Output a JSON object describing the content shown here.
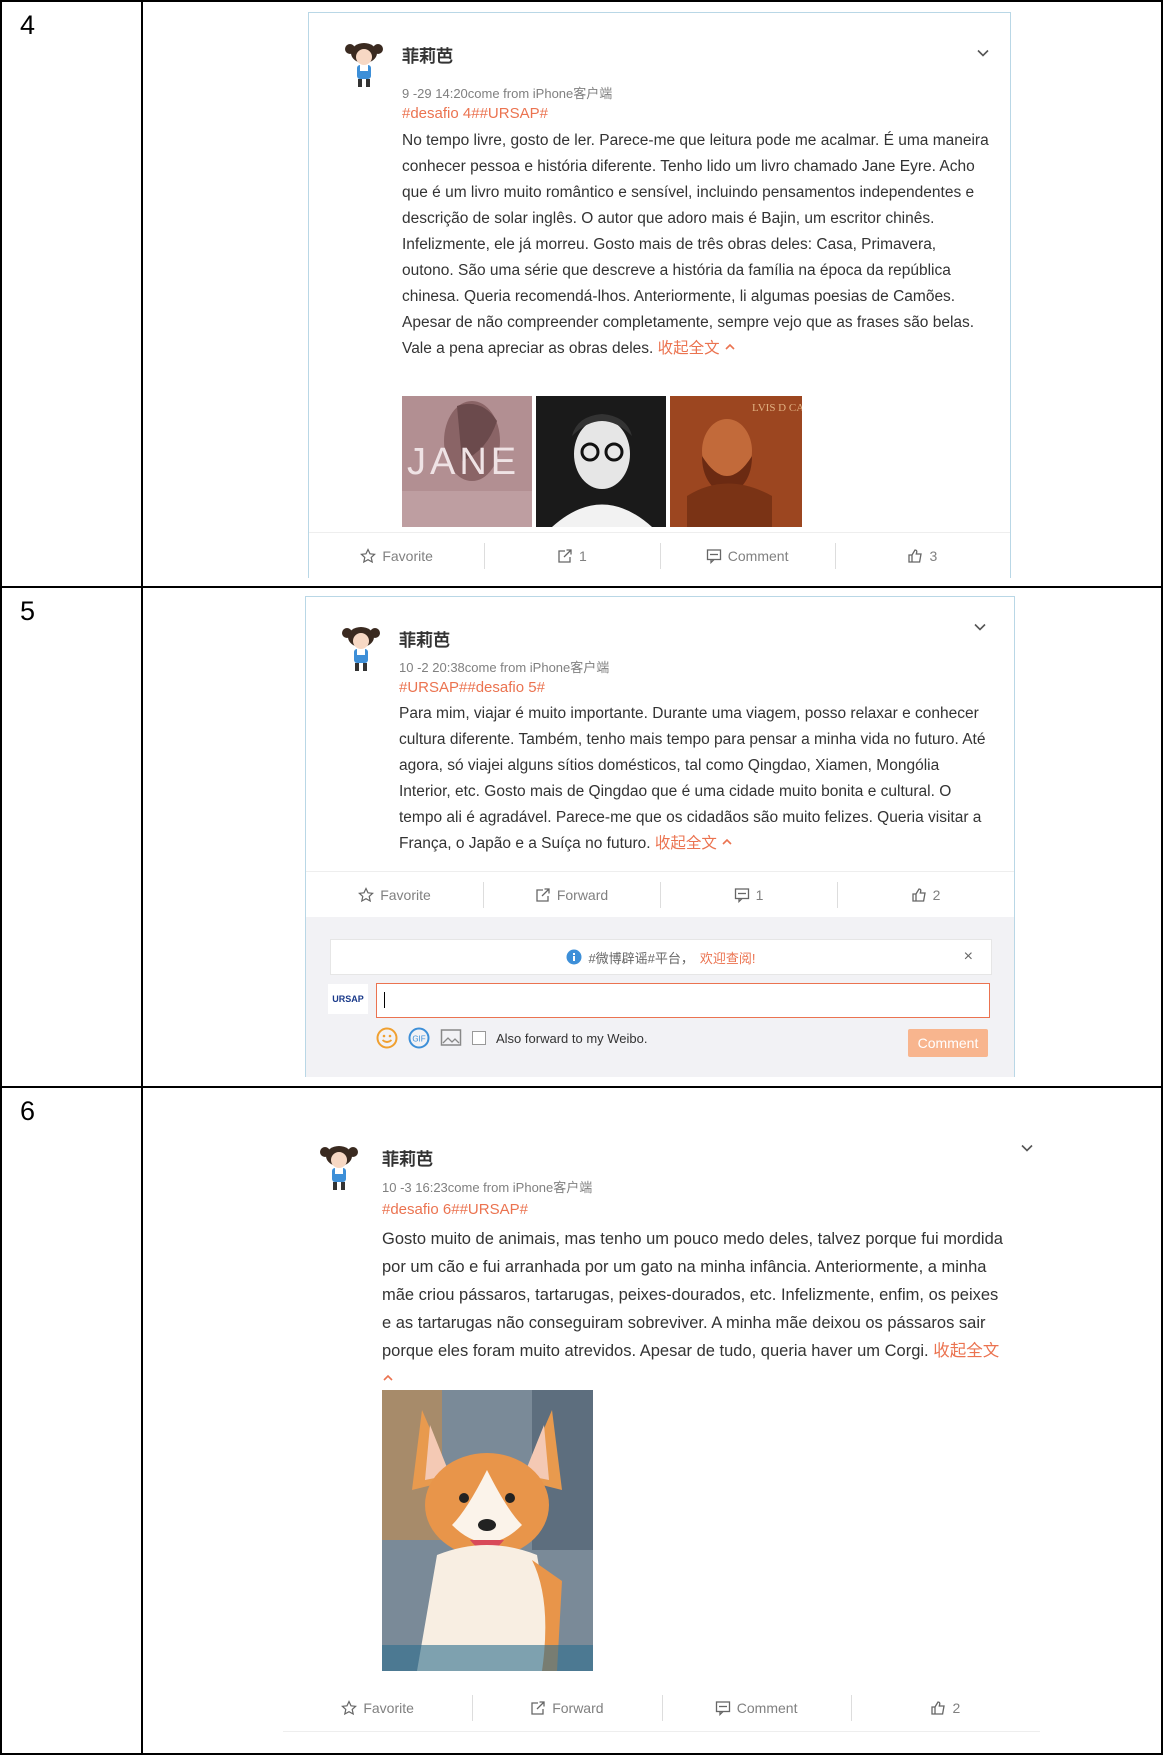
{
  "rows": [
    {
      "num": "4",
      "user": "菲莉芭",
      "meta": "9 -29 14:20come from iPhone客户端",
      "tags": "#desafio 4##URSAP#",
      "text": "No tempo livre, gosto de ler. Parece-me que leitura pode me acalmar. É uma maneira conhecer pessoa e história diferente. Tenho lido um livro chamado Jane Eyre. Acho que é um livro muito romântico e sensível, incluindo pensamentos independentes e descrição de solar inglês. O autor que adoro mais é Bajin, um escritor chinês. Infelizmente, ele já morreu. Gosto mais de três obras deles: Casa, Primavera, outono. São uma série que descreve a história da família na época da república chinesa. Queria recomendá-lhos. Anteriormente, li algumas poesias de Camões. Apesar de não compreender completamente, sempre vejo que as frases são belas. Vale a pena apreciar as obras deles.",
      "collapse": "收起全文",
      "image_texts": {
        "book_title": "JANE EYRE",
        "painting": "LVIS D CAMO"
      },
      "actions": {
        "favorite": "Favorite",
        "forward": "1",
        "comment": "Comment",
        "like": "3"
      }
    },
    {
      "num": "5",
      "user": "菲莉芭",
      "meta": "10 -2 20:38come from iPhone客户端",
      "tags": "#URSAP##desafio 5#",
      "text": "Para mim, viajar é muito importante. Durante uma viagem, posso relaxar e conhecer cultura diferente. Também, tenho mais tempo para pensar a minha vida no futuro. Até agora, só viajei alguns sítios domésticos, tal como Qingdao, Xiamen, Mongólia Interior, etc. Gosto mais de Qingdao que é uma cidade muito bonita e cultural. O tempo ali é agradável. Parece-me que os cidadãos são muito felizes. Queria visitar a França, o Japão e a Suíça no futuro.",
      "collapse": "收起全文",
      "actions": {
        "favorite": "Favorite",
        "forward": "Forward",
        "comment": "1",
        "like": "2"
      },
      "comment_panel": {
        "notice": "#微博辟谣#平台，",
        "notice_link": "欢迎查阅!",
        "close": "×",
        "logo": "URSAP",
        "also_forward": "Also forward to my Weibo.",
        "submit": "Comment"
      }
    },
    {
      "num": "6",
      "user": "菲莉芭",
      "meta": "10 -3 16:23come from iPhone客户端",
      "tags": "#desafio 6##URSAP#",
      "text": "Gosto muito de animais, mas tenho um pouco medo deles, talvez porque fui mordida por um cão e fui arranhada por um gato na minha infância. Anteriormente, a minha mãe criou pássaros, tartarugas, peixes-dourados, etc. Infelizmente, enfim, os peixes e as tartarugas não conseguiram sobreviver. A minha mãe deixou os pássaros sair porque eles foram muito atrevidos. Apesar de tudo, queria haver um Corgi.",
      "collapse": "收起全文",
      "actions": {
        "favorite": "Favorite",
        "forward": "Forward",
        "comment": "Comment",
        "like": "2"
      }
    }
  ],
  "colors": {
    "accent": "#eb7350",
    "meta": "#808080",
    "border": "#b9d7e6"
  }
}
